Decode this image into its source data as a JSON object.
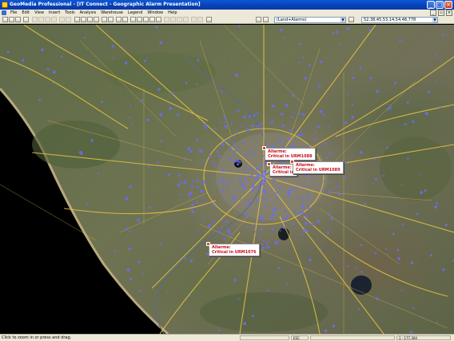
{
  "window": {
    "title": "GeoMedia Professional - [IT Connect - Geographic Alarm Presentation]",
    "minimize": "_",
    "maximize": "□",
    "close": "×"
  },
  "menubar": {
    "items": [
      "File",
      "Edit",
      "View",
      "Insert",
      "Tools",
      "Analysis",
      "Warehouse",
      "Legend",
      "Window",
      "Help"
    ],
    "mdi_minimize": "_",
    "mdi_restore": "▫",
    "mdi_close": "×"
  },
  "toolbar": {
    "layer_combo": "(Land+Alarms)",
    "coord_combo": "52,38,45,53,14,54,48,778"
  },
  "map": {
    "alarms": [
      {
        "line1": "Allarme:",
        "line2": "Critical in URM1088"
      },
      {
        "line1": "Allarme:",
        "line2": "Critical in"
      },
      {
        "line1": "Allarme:",
        "line2": "Critical in URM1089"
      },
      {
        "line1": "Allarme:",
        "line2": "Critical in URM1076"
      }
    ],
    "colors": {
      "sea": "#000000",
      "roads": "#e0c040",
      "markers": "#6a6ef0",
      "alarm_text": "#c8101a"
    }
  },
  "statusbar": {
    "hint": "Click to zoom in or press and drag.",
    "panel1": "",
    "panel2": "ESC",
    "panel3": "",
    "panel4": "1 : 177,304"
  }
}
